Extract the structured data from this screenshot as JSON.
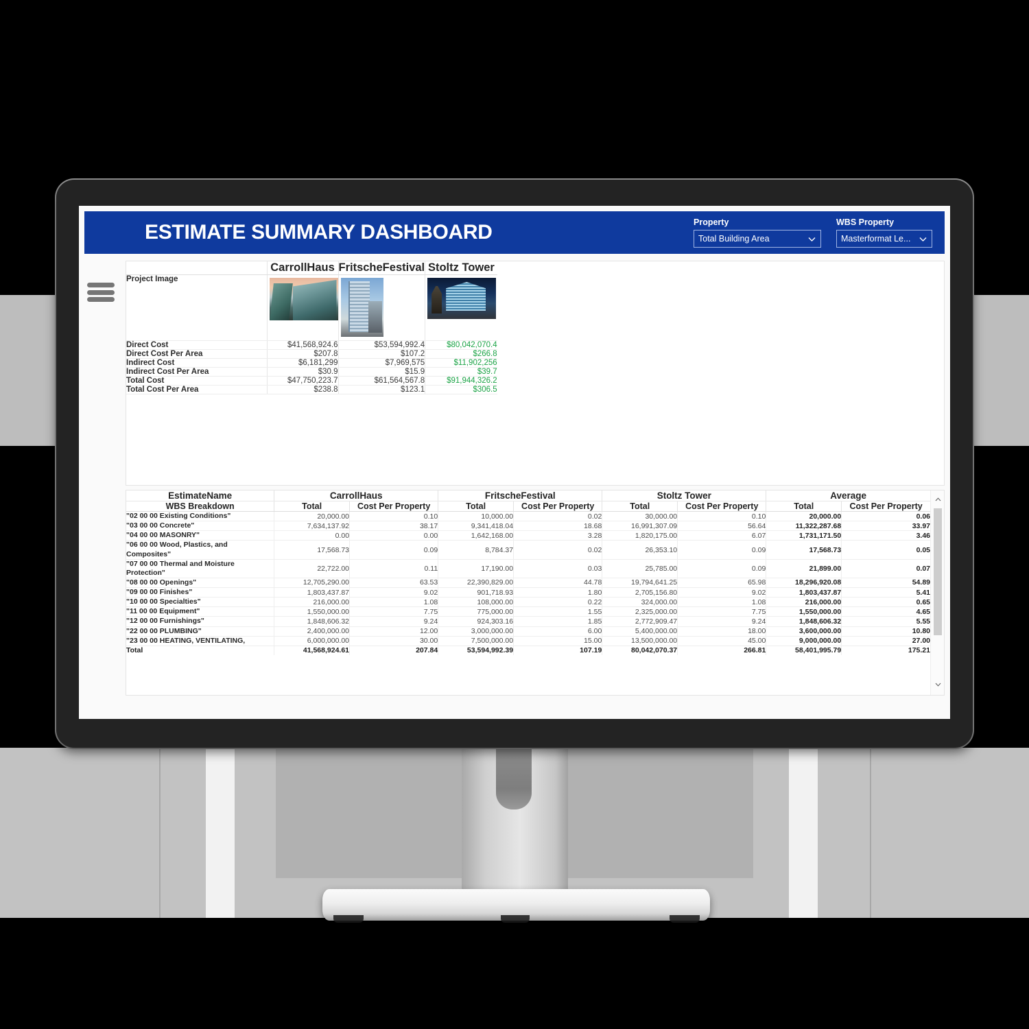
{
  "header": {
    "title": "ESTIMATE SUMMARY DASHBOARD",
    "accent_color": "#0f3a9e",
    "property_label": "Property",
    "property_value": "Total Building Area",
    "wbs_property_label": "WBS Property",
    "wbs_property_value": "Masterformat Le...",
    "chevron_icon": "chevron-down-icon"
  },
  "menu": {
    "icon": "hamburger-menu-icon"
  },
  "summary": {
    "projects": [
      "CarrollHaus",
      "FritscheFestival",
      "Stoltz Tower"
    ],
    "image_row_label": "Project Image",
    "highlight_color": "#1aa345",
    "rows": [
      {
        "label": "Direct Cost",
        "values": [
          "$41,568,924.6",
          "$53,594,992.4",
          "$80,042,070.4"
        ],
        "highlight": [
          false,
          false,
          true
        ]
      },
      {
        "label": "Direct Cost Per Area",
        "values": [
          "$207.8",
          "$107.2",
          "$266.8"
        ],
        "highlight": [
          false,
          false,
          true
        ]
      },
      {
        "label": "Indirect Cost",
        "values": [
          "$6,181,299",
          "$7,969,575",
          "$11,902,256"
        ],
        "highlight": [
          false,
          false,
          true
        ]
      },
      {
        "label": "Indirect Cost Per Area",
        "values": [
          "$30.9",
          "$15.9",
          "$39.7"
        ],
        "highlight": [
          false,
          false,
          true
        ]
      },
      {
        "label": "Total Cost",
        "values": [
          "$47,750,223.7",
          "$61,564,567.8",
          "$91,944,326.2"
        ],
        "highlight": [
          false,
          false,
          true
        ]
      },
      {
        "label": "Total Cost Per Area",
        "values": [
          "$238.8",
          "$123.1",
          "$306.5"
        ],
        "highlight": [
          false,
          false,
          true
        ]
      }
    ]
  },
  "detail": {
    "name_group_header": "EstimateName",
    "name_sub_header": "WBS Breakdown",
    "groups": [
      "CarrollHaus",
      "FritscheFestival",
      "Stoltz Tower",
      "Average"
    ],
    "sub_headers": [
      "Total",
      "Cost Per Property"
    ],
    "rows": [
      {
        "name": "\"02 00 00 Existing Conditions\"",
        "cells": [
          "20,000.00",
          "0.10",
          "10,000.00",
          "0.02",
          "30,000.00",
          "0.10",
          "20,000.00",
          "0.06"
        ]
      },
      {
        "name": "\"03 00 00 Concrete\"",
        "cells": [
          "7,634,137.92",
          "38.17",
          "9,341,418.04",
          "18.68",
          "16,991,307.09",
          "56.64",
          "11,322,287.68",
          "33.97"
        ]
      },
      {
        "name": "\"04 00 00 MASONRY\"",
        "cells": [
          "0.00",
          "0.00",
          "1,642,168.00",
          "3.28",
          "1,820,175.00",
          "6.07",
          "1,731,171.50",
          "3.46"
        ]
      },
      {
        "name": "\"06 00 00 Wood, Plastics, and Composites\"",
        "cells": [
          "17,568.73",
          "0.09",
          "8,784.37",
          "0.02",
          "26,353.10",
          "0.09",
          "17,568.73",
          "0.05"
        ]
      },
      {
        "name": "\"07 00 00 Thermal and Moisture Protection\"",
        "cells": [
          "22,722.00",
          "0.11",
          "17,190.00",
          "0.03",
          "25,785.00",
          "0.09",
          "21,899.00",
          "0.07"
        ]
      },
      {
        "name": "\"08 00 00 Openings\"",
        "cells": [
          "12,705,290.00",
          "63.53",
          "22,390,829.00",
          "44.78",
          "19,794,641.25",
          "65.98",
          "18,296,920.08",
          "54.89"
        ]
      },
      {
        "name": "\"09 00 00 Finishes\"",
        "cells": [
          "1,803,437.87",
          "9.02",
          "901,718.93",
          "1.80",
          "2,705,156.80",
          "9.02",
          "1,803,437.87",
          "5.41"
        ]
      },
      {
        "name": "\"10 00 00 Specialties\"",
        "cells": [
          "216,000.00",
          "1.08",
          "108,000.00",
          "0.22",
          "324,000.00",
          "1.08",
          "216,000.00",
          "0.65"
        ]
      },
      {
        "name": "\"11 00 00 Equipment\"",
        "cells": [
          "1,550,000.00",
          "7.75",
          "775,000.00",
          "1.55",
          "2,325,000.00",
          "7.75",
          "1,550,000.00",
          "4.65"
        ]
      },
      {
        "name": "\"12 00 00 Furnishings\"",
        "cells": [
          "1,848,606.32",
          "9.24",
          "924,303.16",
          "1.85",
          "2,772,909.47",
          "9.24",
          "1,848,606.32",
          "5.55"
        ]
      },
      {
        "name": "\"22 00 00 PLUMBING\"",
        "cells": [
          "2,400,000.00",
          "12.00",
          "3,000,000.00",
          "6.00",
          "5,400,000.00",
          "18.00",
          "3,600,000.00",
          "10.80"
        ]
      },
      {
        "name": "\"23 00 00 HEATING, VENTILATING,",
        "cells": [
          "6,000,000.00",
          "30.00",
          "7,500,000.00",
          "15.00",
          "13,500,000.00",
          "45.00",
          "9,000,000.00",
          "27.00"
        ]
      }
    ],
    "total_row": {
      "name": "Total",
      "cells": [
        "41,568,924.61",
        "207.84",
        "53,594,992.39",
        "107.19",
        "80,042,070.37",
        "266.81",
        "58,401,995.79",
        "175.21"
      ]
    },
    "scroll_up_icon": "chevron-up-icon",
    "scroll_down_icon": "chevron-down-icon"
  }
}
